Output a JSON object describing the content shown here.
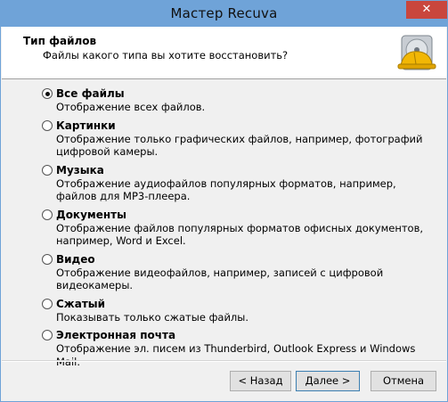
{
  "window": {
    "title": "Мастер Recuva",
    "close_glyph": "✕"
  },
  "header": {
    "title": "Тип файлов",
    "subtitle": "Файлы какого типа вы хотите восстановить?"
  },
  "options": [
    {
      "label": "Все файлы",
      "description": "Отображение всех файлов.",
      "checked": true
    },
    {
      "label": "Картинки",
      "description": "Отображение только графических файлов, например, фотографий цифровой камеры.",
      "checked": false
    },
    {
      "label": "Музыка",
      "description": "Отображение аудиофайлов популярных форматов, например, файлов для MP3-плеера.",
      "checked": false
    },
    {
      "label": "Документы",
      "description": "Отображение файлов популярных форматов офисных документов, например, Word и Excel.",
      "checked": false
    },
    {
      "label": "Видео",
      "description": "Отображение видеофайлов, например, записей с цифровой видеокамеры.",
      "checked": false
    },
    {
      "label": "Сжатый",
      "description": "Показывать только сжатые файлы.",
      "checked": false
    },
    {
      "label": "Электронная почта",
      "description": "Отображение эл. писем из Thunderbird, Outlook Express и Windows Mail.",
      "checked": false
    }
  ],
  "buttons": {
    "back": "< Назад",
    "next": "Далее >",
    "cancel": "Отмена"
  },
  "colors": {
    "titlebar": "#6fa3d8",
    "close": "#c9463d",
    "header_bg": "#ffffff",
    "window_bg": "#f0f0f0"
  }
}
